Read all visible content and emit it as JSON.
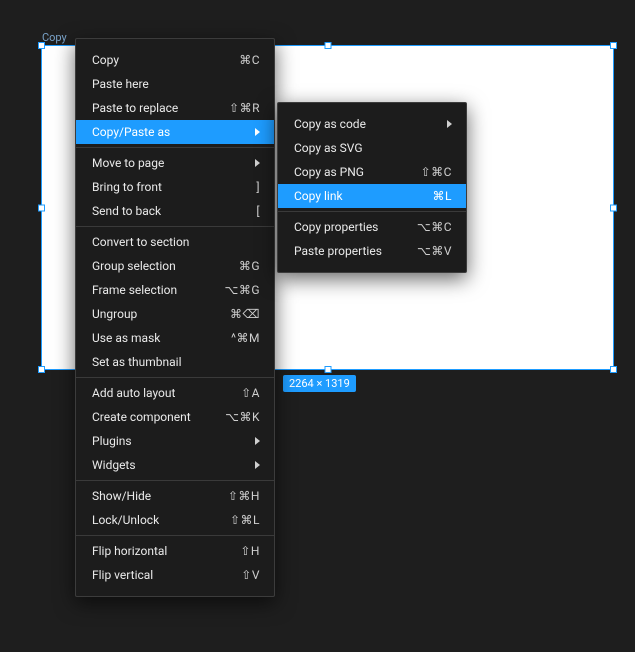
{
  "canvas": {
    "frame_label": "Copy",
    "dimensions_badge": "2264 × 1319"
  },
  "main_menu": {
    "groups": [
      [
        {
          "label": "Copy",
          "shortcut": "⌘C"
        },
        {
          "label": "Paste here",
          "shortcut": ""
        },
        {
          "label": "Paste to replace",
          "shortcut": "⇧⌘R"
        },
        {
          "label": "Copy/Paste as",
          "submenu": true,
          "highlight": true
        }
      ],
      [
        {
          "label": "Move to page",
          "submenu": true
        },
        {
          "label": "Bring to front",
          "shortcut": "]"
        },
        {
          "label": "Send to back",
          "shortcut": "["
        }
      ],
      [
        {
          "label": "Convert to section",
          "shortcut": ""
        },
        {
          "label": "Group selection",
          "shortcut": "⌘G"
        },
        {
          "label": "Frame selection",
          "shortcut": "⌥⌘G"
        },
        {
          "label": "Ungroup",
          "shortcut": "⌘⌫"
        },
        {
          "label": "Use as mask",
          "shortcut": "^⌘M"
        },
        {
          "label": "Set as thumbnail",
          "shortcut": ""
        }
      ],
      [
        {
          "label": "Add auto layout",
          "shortcut": "⇧A"
        },
        {
          "label": "Create component",
          "shortcut": "⌥⌘K"
        },
        {
          "label": "Plugins",
          "submenu": true
        },
        {
          "label": "Widgets",
          "submenu": true
        }
      ],
      [
        {
          "label": "Show/Hide",
          "shortcut": "⇧⌘H"
        },
        {
          "label": "Lock/Unlock",
          "shortcut": "⇧⌘L"
        }
      ],
      [
        {
          "label": "Flip horizontal",
          "shortcut": "⇧H"
        },
        {
          "label": "Flip vertical",
          "shortcut": "⇧V"
        }
      ]
    ]
  },
  "sub_menu": {
    "groups": [
      [
        {
          "label": "Copy as code",
          "submenu": true
        },
        {
          "label": "Copy as SVG",
          "shortcut": ""
        },
        {
          "label": "Copy as PNG",
          "shortcut": "⇧⌘C"
        },
        {
          "label": "Copy link",
          "shortcut": "⌘L",
          "highlight": true
        }
      ],
      [
        {
          "label": "Copy properties",
          "shortcut": "⌥⌘C"
        },
        {
          "label": "Paste properties",
          "shortcut": "⌥⌘V"
        }
      ]
    ]
  }
}
